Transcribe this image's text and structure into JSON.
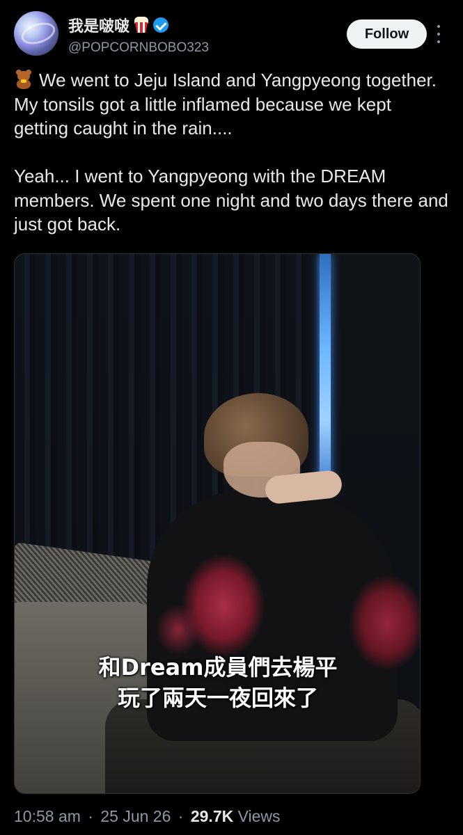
{
  "author": {
    "display_name": "我是啵啵",
    "handle": "@POPCORNBOBO323",
    "emoji_icon": "popcorn-icon",
    "verified": true,
    "verified_color": "#1d9bf0"
  },
  "follow_button": {
    "label": "Follow"
  },
  "tweet": {
    "paragraph1": "We went to Jeju Island and Yangpyeong together. My tonsils got a little inflamed because we kept getting caught in the rain....",
    "paragraph1_icon": "teddy-bear-icon",
    "paragraph2": "Yeah... I went to Yangpyeong with the DREAM members. We spent one night and two days there and just got back."
  },
  "media": {
    "subtitle_line1": "和Dream成員們去楊平",
    "subtitle_line2": "玩了兩天一夜回來了"
  },
  "meta": {
    "time": "10:58 am",
    "date": "25 Jun 26",
    "views_count": "29.7K",
    "views_label": "Views",
    "separator": "·"
  }
}
